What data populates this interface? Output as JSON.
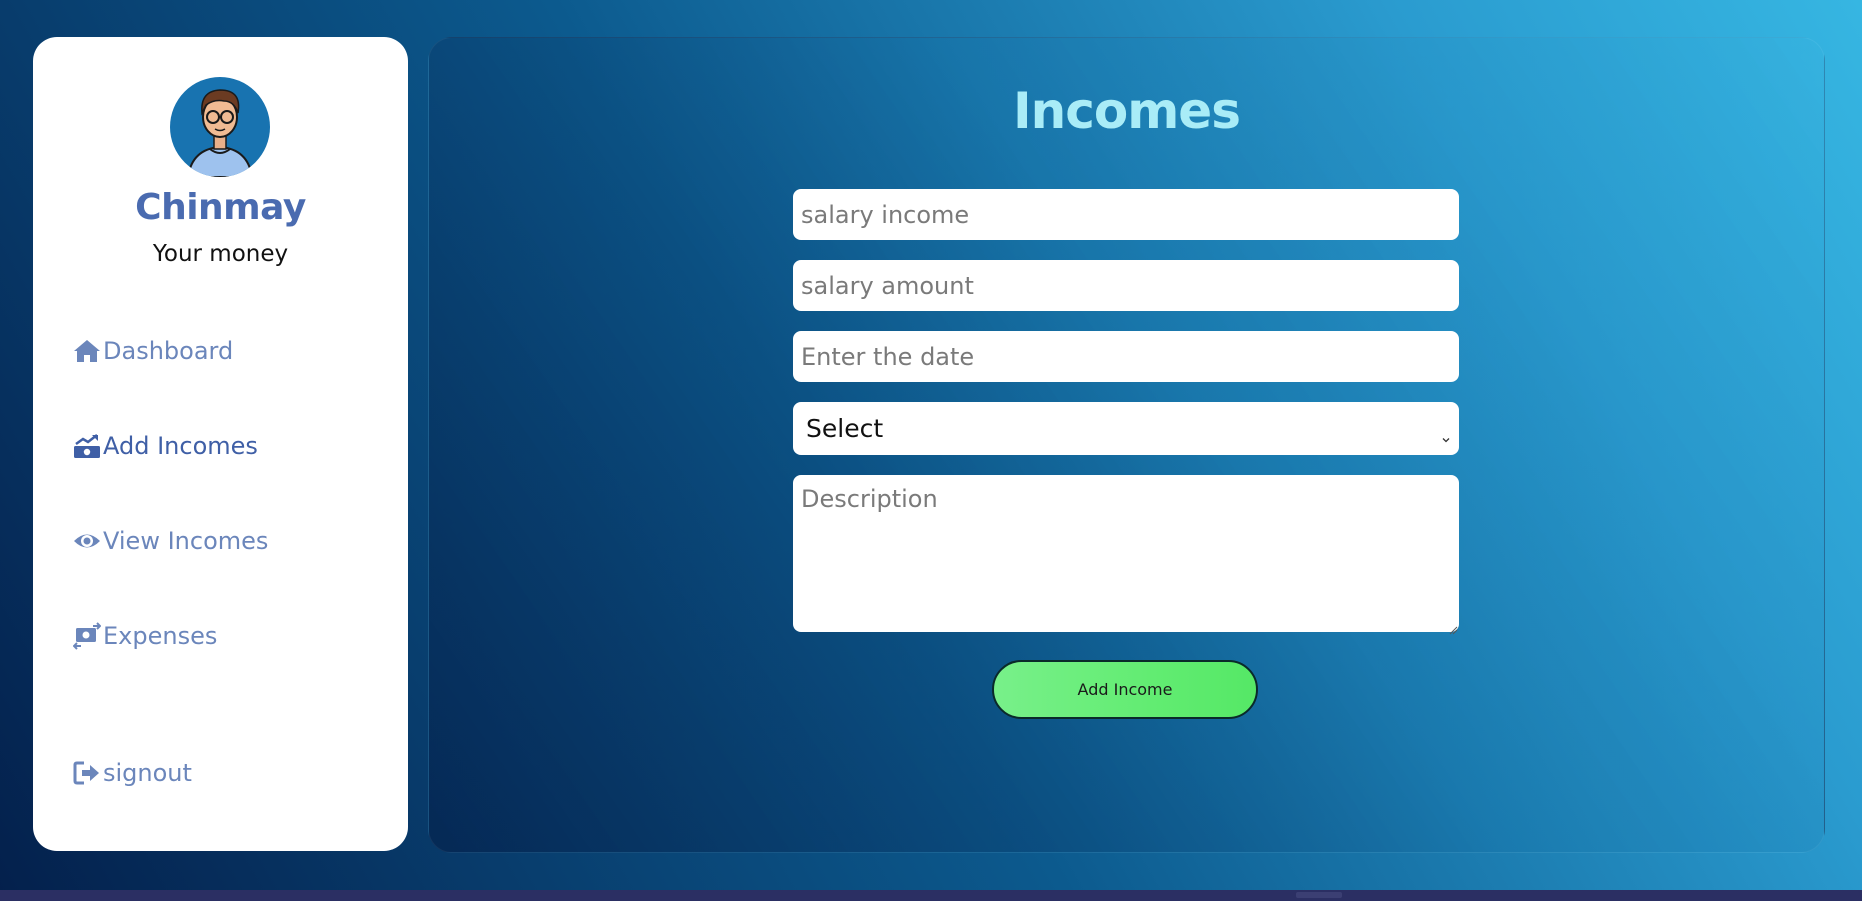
{
  "sidebar": {
    "username": "Chinmay",
    "tagline": "Your money",
    "items": [
      {
        "label": "Dashboard",
        "icon": "home-icon"
      },
      {
        "label": "Add Incomes",
        "icon": "money-trend-icon"
      },
      {
        "label": "View Incomes",
        "icon": "eye-icon"
      },
      {
        "label": "Expenses",
        "icon": "money-exchange-icon"
      },
      {
        "label": "signout",
        "icon": "signout-icon"
      }
    ]
  },
  "main": {
    "title": "Incomes",
    "form": {
      "title_placeholder": "salary income",
      "amount_placeholder": "salary amount",
      "date_placeholder": "Enter the date",
      "category_selected": "Select",
      "description_placeholder": "Description",
      "submit_label": "Add Income"
    }
  },
  "colors": {
    "accent_green": "#62ec72",
    "title_cyan": "#a9ecf7",
    "nav_text": "#6b86bb",
    "nav_active": "#3f5fa6",
    "username": "#4a6bb0"
  }
}
